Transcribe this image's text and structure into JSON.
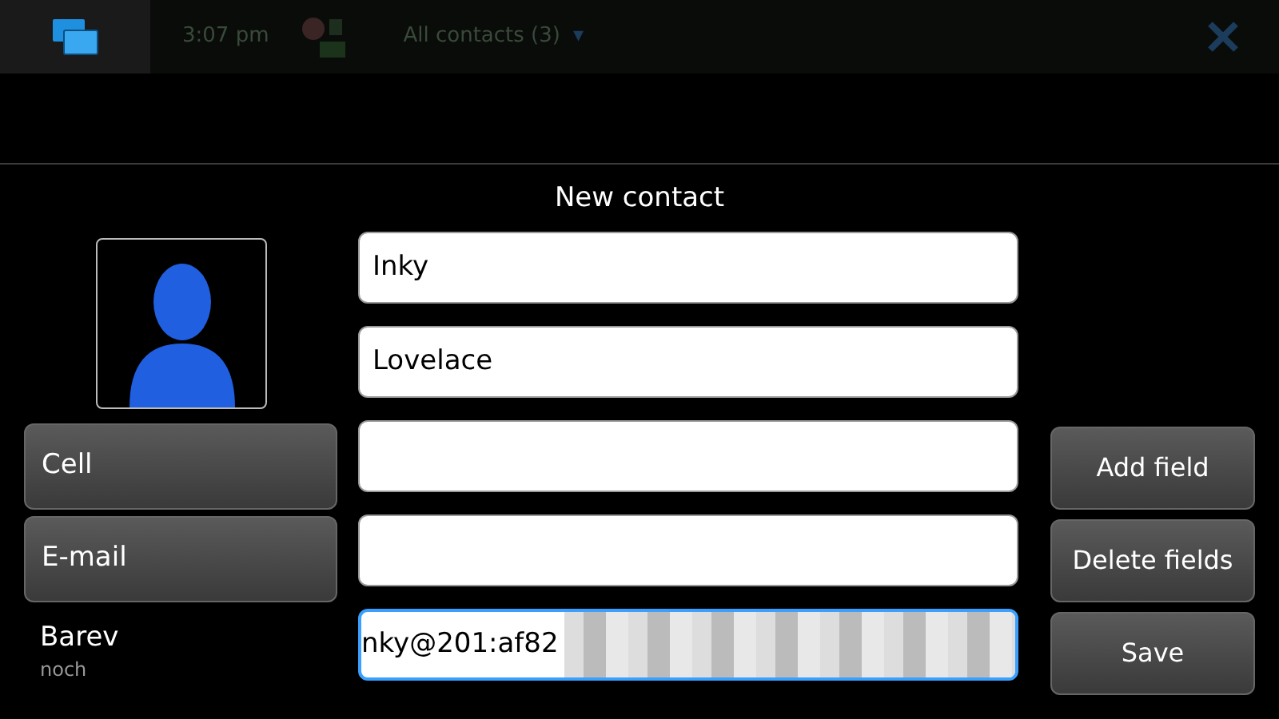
{
  "status_bar": {
    "time": "3:07 pm",
    "view": "All contacts (3)",
    "caret": "▾"
  },
  "dialog": {
    "title": "New contact"
  },
  "detail_buttons": [
    "Cell",
    "E-mail"
  ],
  "account": {
    "name": "Barev",
    "status": "noch"
  },
  "fields": [
    {
      "value": "Inky",
      "focused": false
    },
    {
      "value": "Lovelace",
      "focused": false
    },
    {
      "focused": false
    },
    {
      "focused": false
    },
    {
      "value": "nky@201:af82",
      "focused": true,
      "redacted": true
    }
  ],
  "actions": [
    "Add field",
    "Delete fields",
    "Save"
  ]
}
